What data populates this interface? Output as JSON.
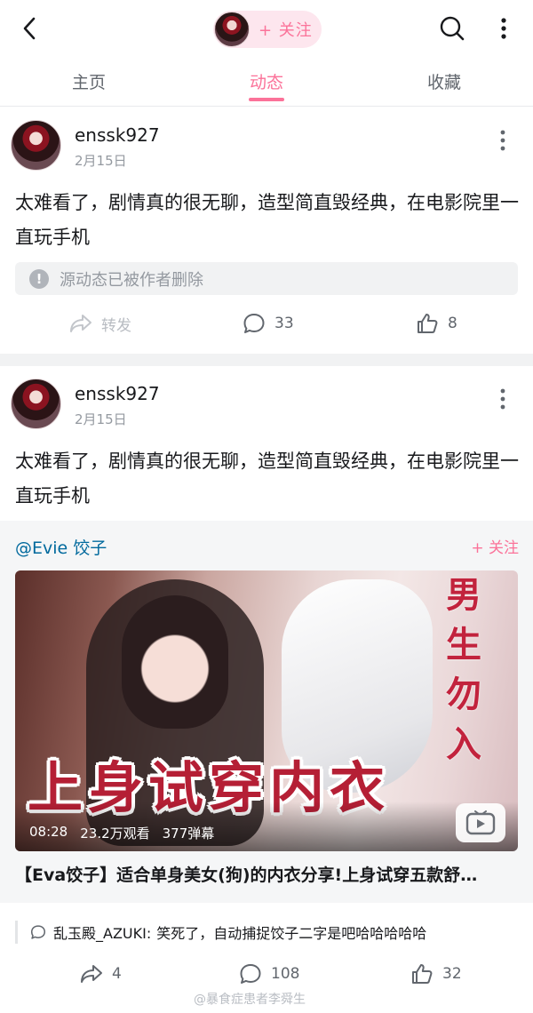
{
  "header": {
    "follow_label": "+ 关注"
  },
  "tabs": [
    {
      "label": "主页"
    },
    {
      "label": "动态"
    },
    {
      "label": "收藏"
    }
  ],
  "posts": [
    {
      "username": "enssk927",
      "date": "2月15日",
      "text": "太难看了，剧情真的很无聊，造型简直毁经典，在电影院里一直玩手机",
      "deleted_notice": "源动态已被作者删除",
      "actions": {
        "forward": "转发",
        "comments": "33",
        "likes": "8"
      }
    },
    {
      "username": "enssk927",
      "date": "2月15日",
      "text": "太难看了，剧情真的很无聊，造型简直毁经典，在电影院里一直玩手机",
      "shared": {
        "uploader": "@Evie 饺子",
        "follow_label": "+ 关注",
        "thumb_side_text": [
          "男",
          "生",
          "勿",
          "入"
        ],
        "thumb_big_text": "上身试穿内衣",
        "duration": "08:28",
        "views": "23.2万观看",
        "danmaku": "377弹幕",
        "title": "【Eva饺子】适合单身美女(狗)的内衣分享!上身试穿五款舒…"
      },
      "comment_preview": {
        "user": "乱玉殿_AZUKI:",
        "text": "笑死了，自动捕捉饺子二字是吧哈哈哈哈哈"
      },
      "actions": {
        "forward": "4",
        "comments": "108",
        "likes": "32"
      }
    }
  ],
  "watermark": "@暴食症患者李舜生",
  "colors": {
    "accent": "#fb7299",
    "link": "#00699d",
    "text": "#18191c",
    "muted": "#9499a0"
  }
}
